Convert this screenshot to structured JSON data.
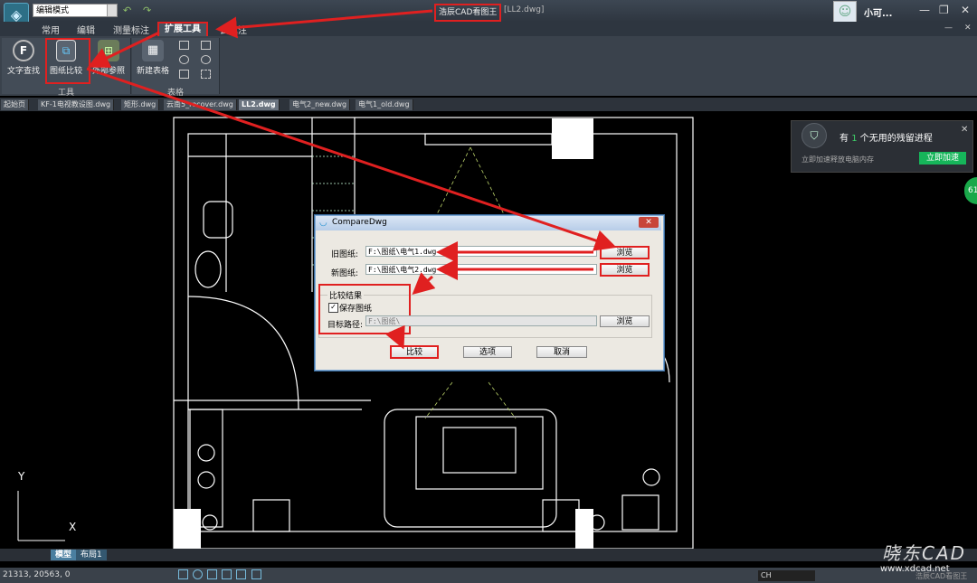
{
  "title_bar": {
    "mode_select": "编辑模式",
    "app_title": "浩辰CAD看图王",
    "file_title": "[LL2.dwg]",
    "user_name": "小可..."
  },
  "menu": {
    "items": [
      "常用",
      "编辑",
      "测量标注",
      "扩展工具",
      "云批注"
    ]
  },
  "ribbon": {
    "text_search": "文字查找",
    "drawing_compare": "图纸比较",
    "xref": "外部参照",
    "new_table": "新建表格",
    "group_tools": "工具",
    "group_table": "表格"
  },
  "tabs": [
    "起始页",
    "KF-1电视教设图.dwg",
    "矩形.dwg",
    "云南5_recover.dwg",
    "LL2.dwg",
    "电气2_new.dwg",
    "电气1_old.dwg"
  ],
  "active_tab": "LL2.dwg",
  "dialog": {
    "title": "CompareDwg",
    "old_label": "旧图纸:",
    "old_path": "F:\\图纸\\电气1.dwg",
    "new_label": "新图纸:",
    "new_path": "F:\\图纸\\电气2.dwg",
    "browse": "浏览",
    "result_group": "比较结果",
    "save_checkbox": "保存图纸",
    "target_label": "目标路径:",
    "target_path": "F:\\图纸\\",
    "compare_button": "比较",
    "options_button": "选项",
    "cancel_button": "取消"
  },
  "notification": {
    "title_pre": "有",
    "title_count": "1",
    "title_post": "个无用的残留进程",
    "subtitle": "立即加速释放电脑内存",
    "button": "立即加速"
  },
  "side_badge": "61",
  "bottom": {
    "model_tab": "模型",
    "layout_tab": "布局1",
    "coords": "21313, 20563, 0",
    "ime": "CH",
    "brand": "浩辰CAD看图王"
  },
  "axis": {
    "y": "Y",
    "x": "X"
  },
  "watermark": {
    "text": "晓东CAD",
    "url": "www.xdcad.net"
  }
}
